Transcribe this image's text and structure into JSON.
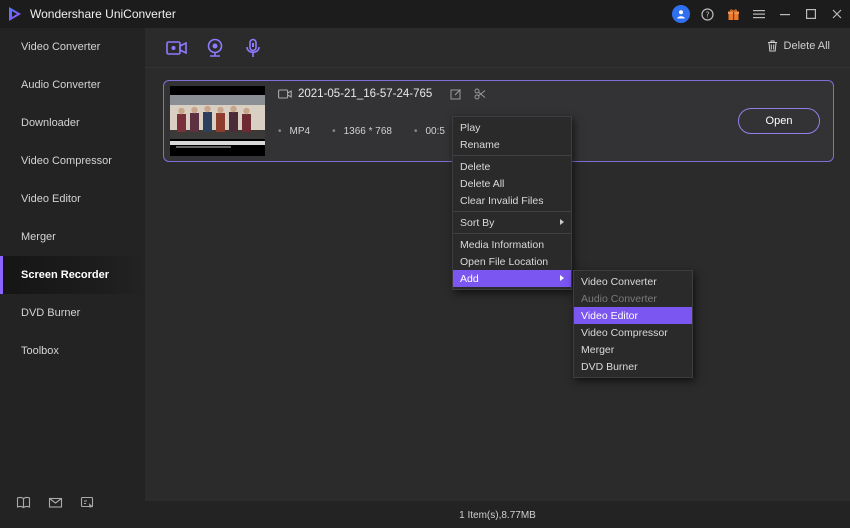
{
  "app": {
    "title": "Wondershare UniConverter"
  },
  "sidebar": {
    "items": [
      {
        "label": "Video Converter"
      },
      {
        "label": "Audio Converter"
      },
      {
        "label": "Downloader"
      },
      {
        "label": "Video Compressor"
      },
      {
        "label": "Video Editor"
      },
      {
        "label": "Merger"
      },
      {
        "label": "Screen Recorder",
        "active": true
      },
      {
        "label": "DVD Burner"
      },
      {
        "label": "Toolbox"
      }
    ]
  },
  "toolbar": {
    "delete_all": "Delete All"
  },
  "file": {
    "name": "2021-05-21_16-57-24-765",
    "format": "MP4",
    "resolution": "1366 * 768",
    "duration_partial": "00:5",
    "open_label": "Open"
  },
  "context_menu": {
    "items": [
      "Play",
      "Rename",
      "Delete",
      "Delete All",
      "Clear Invalid Files",
      "Sort By",
      "Media Information",
      "Open File Location",
      "Add"
    ]
  },
  "submenu": {
    "items": [
      "Video Converter",
      "Audio Converter",
      "Video Editor",
      "Video Compressor",
      "Merger",
      "DVD Burner"
    ]
  },
  "status": {
    "summary": "1 Item(s),8.77MB"
  },
  "colors": {
    "accent": "#7b56f1",
    "avatar": "#2f6ff0",
    "gift": "#f07a2b"
  }
}
